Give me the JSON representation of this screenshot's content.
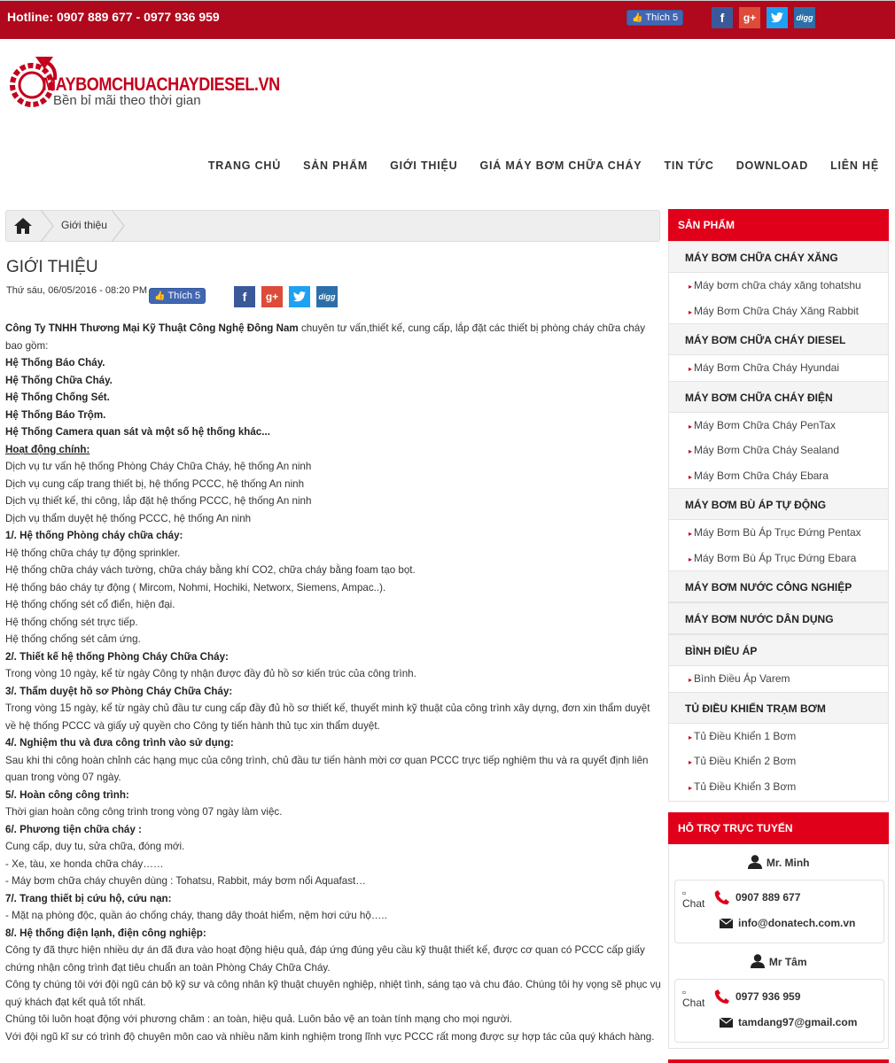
{
  "topbar": {
    "hotline": "Hotline: 0907 889 677  -  0977 936 959",
    "like_label": "Thích 5",
    "share": {
      "facebook": "f",
      "googleplus": "g+",
      "twitter": "t",
      "digg": "digg"
    }
  },
  "logo": {
    "name": "MAYBOMCHUACHAYDIESEL.VN",
    "slogan": "Bền bỉ mãi theo thời gian"
  },
  "nav": [
    "TRANG CHỦ",
    "SẢN PHẨM",
    "GIỚI THIỆU",
    "GIÁ MÁY BƠM CHỮA CHÁY",
    "TIN TỨC",
    "DOWNLOAD",
    "LIÊN HỆ"
  ],
  "breadcrumb": {
    "current": "Giới thiệu"
  },
  "article": {
    "title": "GIỚI THIỆU",
    "date": "Thứ sáu, 06/05/2016 - 08:20 PM",
    "like_label": "Thích 5",
    "intro_company": "Công Ty TNHH Thương Mại Kỹ Thuật Công Nghệ Đông Nam",
    "intro_rest": " chuyên tư vấn,thiết kế, cung cấp, lắp đặt các thiết bị phòng cháy chữa cháy bao gồm:",
    "systems": [
      "Hệ Thống Báo Cháy.",
      "Hệ Thống Chữa Cháy.",
      "Hệ Thống Chống Sét.",
      "Hệ Thống Báo Trộm.",
      "Hệ Thống Camera quan sát và một số hệ thống khác..."
    ],
    "activities_heading": "Hoạt động chính:",
    "activities": [
      "Dịch vụ tư vấn hệ thống Phòng Cháy Chữa Cháy, hệ thống An ninh",
      "Dịch vụ cung cấp trang thiết bị, hệ thống PCCC, hệ thống An ninh",
      "Dịch vụ thiết kế, thi công, lắp đặt hệ thống PCCC, hệ thống An ninh",
      "Dịch vụ thẩm duyệt hệ thống PCCC, hệ thống An ninh"
    ],
    "s1_heading": "1/. Hệ thống Phòng cháy chữa cháy:",
    "s1_items": [
      "Hệ thống chữa cháy tự động sprinkler.",
      "Hệ thống chữa cháy vách tường, chữa cháy bằng khí CO2, chữa cháy bằng foam tạo bọt.",
      "Hệ thống báo cháy tự động ( Mircom, Nohmi, Hochiki, Networx, Siemens, Ampac..).",
      "Hệ thống chống sét cổ điển, hiện đại.",
      "Hệ thống chống sét trực tiếp.",
      "Hệ thống chống sét cảm ứng."
    ],
    "s2_heading": "2/. Thiết kế hệ thống Phòng Cháy Chữa Cháy:",
    "s2_text": "Trong vòng 10 ngày, kể từ ngày Công ty nhận được đầy đủ hồ sơ kiến trúc của công trình.",
    "s3_heading": "3/. Thẩm duyệt hồ sơ Phòng Cháy Chữa Cháy:",
    "s3_text": "Trong vòng 15 ngày, kể từ ngày chủ đầu tư cung cấp đầy đủ hồ sơ thiết kế, thuyết minh kỹ thuật của công trình xây dựng, đơn xin thẩm duyệt về hệ thống PCCC và giấy uỷ quyền cho Công ty tiến hành thủ tục xin thẩm duyệt.",
    "s4_heading": "4/. Nghiệm thu và đưa công trình vào sử dụng:",
    "s4_text": "Sau khi thi công hoàn chỉnh các hạng mục của công trình, chủ đầu tư tiến hành mời cơ quan PCCC trực tiếp nghiệm thu và ra quyết định liên quan trong vòng 07 ngày.",
    "s5_heading": "5/. Hoàn công công trình:",
    "s5_text": "Thời gian hoàn công công trình trong vòng 07 ngày làm việc.",
    "s6_heading": "6/. Phương tiện chữa cháy :",
    "s6_items": [
      "Cung cấp, duy tu, sửa chữa, đóng mới.",
      "- Xe, tàu, xe honda chữa cháy……",
      "- Máy bơm chữa cháy chuyên dùng : Tohatsu, Rabbit, máy bơm nổi Aquafast…"
    ],
    "s7_heading": "7/. Trang thiết bị cứu hộ, cứu nạn:",
    "s7_text": "- Mặt nạ phòng độc, quần áo chống cháy, thang dây thoát hiểm, nệm hơi cứu hộ…..",
    "s8_heading": "8/. Hệ thống điện lạnh, điện công nghiệp:",
    "s8_items": [
      "Công ty đã thực hiện nhiều dự án đã đưa vào hoạt động hiệu quả, đáp ứng đúng yêu cầu kỹ thuật thiết kế, được cơ quan có PCCC cấp giấy chứng nhận công trình đạt tiêu chuẩn an toàn Phòng Cháy Chữa Cháy.",
      "Công ty chúng tôi với đội ngũ cán bộ kỹ sư và công nhân kỹ thuật chuyên nghiệp, nhiệt tình, sáng tạo và chu đáo. Chúng tôi hy vọng sẽ phục vụ quý khách đạt kết quả tốt nhất.",
      "Chúng tôi luôn hoạt động với phương châm : an toàn, hiệu quả. Luôn bảo vệ an toàn tính mạng cho mọi người.",
      "Với đội ngũ kĩ sư có trình độ chuyên môn cao và nhiều năm kinh nghiệm trong lĩnh vực PCCC rất mong được sự hợp tác của quý khách hàng."
    ]
  },
  "sidebar": {
    "products_title": "SẢN PHẨM",
    "categories": [
      {
        "label": "MÁY BƠM CHỮA CHÁY XĂNG",
        "items": [
          "Máy bơm chữa cháy xăng tohatshu",
          "Máy Bơm Chữa Cháy Xăng Rabbit"
        ]
      },
      {
        "label": "MÁY BƠM CHỮA CHÁY DIESEL",
        "items": [
          "Máy Bơm Chữa Cháy Hyundai"
        ]
      },
      {
        "label": "MÁY BƠM CHỮA CHÁY ĐIỆN",
        "items": [
          "Máy Bơm Chữa Cháy PenTax",
          "Máy Bơm Chữa Cháy Sealand",
          "Máy Bơm Chữa Cháy Ebara"
        ]
      },
      {
        "label": "MÁY BƠM BÙ ÁP TỰ ĐỘNG",
        "items": [
          "Máy Bơm Bù Áp Trục Đứng Pentax",
          "Máy Bơm Bù Áp Trục Đứng Ebara"
        ]
      },
      {
        "label": "MÁY BƠM NƯỚC CÔNG NGHIỆP",
        "items": []
      },
      {
        "label": "MÁY BƠM NƯỚC DÂN DỤNG",
        "items": []
      },
      {
        "label": "BÌNH ĐIỀU ÁP",
        "items": [
          "Bình Điều Áp Varem"
        ]
      },
      {
        "label": "TỦ ĐIỀU KHIỂN TRẠM BƠM",
        "items": [
          "Tủ Điều Khiển 1 Bơm",
          "Tủ Điều Khiển 2 Bơm",
          "Tủ Điều Khiển 3 Bơm"
        ]
      }
    ],
    "support_title": "HỖ TRỢ TRỰC TUYẾN",
    "supporters": [
      {
        "name": "Mr. Minh",
        "chat": "Chat",
        "phone": "0907 889 677",
        "email": "info@donatech.com.vn"
      },
      {
        "name": "Mr Tâm",
        "chat": "Chat",
        "phone": "0977 936 959",
        "email": "tamdang97@gmail.com"
      }
    ]
  }
}
